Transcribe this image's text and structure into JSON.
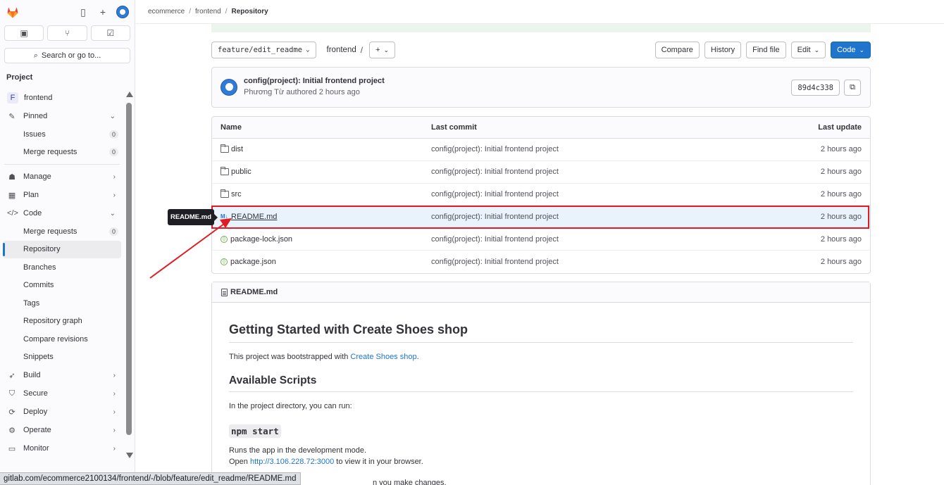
{
  "sidebar": {
    "search_label": "Search or go to...",
    "section_title": "Project",
    "project_initial": "F",
    "project_name": "frontend",
    "items": {
      "pinned": "Pinned",
      "issues": "Issues",
      "issues_count": "0",
      "merge_requests": "Merge requests",
      "merge_requests_count": "0",
      "manage": "Manage",
      "plan": "Plan",
      "code": "Code",
      "code_merge_requests": "Merge requests",
      "code_merge_requests_count": "0",
      "repository": "Repository",
      "branches": "Branches",
      "commits": "Commits",
      "tags": "Tags",
      "repository_graph": "Repository graph",
      "compare_revisions": "Compare revisions",
      "snippets": "Snippets",
      "build": "Build",
      "secure": "Secure",
      "deploy": "Deploy",
      "operate": "Operate",
      "monitor": "Monitor"
    }
  },
  "breadcrumb": [
    "ecommerce",
    "frontend",
    "Repository"
  ],
  "toolbar": {
    "branch": "feature/edit_readme",
    "path_root": "frontend",
    "path_sep": "/",
    "add_label": "+",
    "compare": "Compare",
    "history": "History",
    "find_file": "Find file",
    "edit": "Edit",
    "code": "Code"
  },
  "commit": {
    "title": "config(project): Initial frontend project",
    "author": "Phương Từ",
    "authored_text": "authored 2 hours ago",
    "sha": "89d4c338"
  },
  "table": {
    "headers": {
      "name": "Name",
      "last_commit": "Last commit",
      "last_update": "Last update"
    },
    "rows": [
      {
        "name": "dist",
        "commit": "config(project): Initial frontend project",
        "updated": "2 hours ago",
        "type": "folder"
      },
      {
        "name": "public",
        "commit": "config(project): Initial frontend project",
        "updated": "2 hours ago",
        "type": "folder"
      },
      {
        "name": "src",
        "commit": "config(project): Initial frontend project",
        "updated": "2 hours ago",
        "type": "folder"
      },
      {
        "name": "README.md",
        "commit": "config(project): Initial frontend project",
        "updated": "2 hours ago",
        "type": "markdown"
      },
      {
        "name": "package-lock.json",
        "commit": "config(project): Initial frontend project",
        "updated": "2 hours ago",
        "type": "json"
      },
      {
        "name": "package.json",
        "commit": "config(project): Initial frontend project",
        "updated": "2 hours ago",
        "type": "json"
      }
    ]
  },
  "tooltip": "README.md",
  "readme": {
    "file_name": "README.md",
    "h1": "Getting Started with Create Shoes shop",
    "p1_prefix": "This project was bootstrapped with ",
    "p1_link": "Create Shoes shop",
    "p1_suffix": ".",
    "h2": "Available Scripts",
    "p2": "In the project directory, you can run:",
    "code_heading": "npm start",
    "p3": "Runs the app in the development mode.",
    "p4_prefix": "Open ",
    "p4_link": "http://3.106.228.72:3000",
    "p4_suffix": " to view it in your browser.",
    "p5_partial": "n you make changes."
  },
  "status_url": "gitlab.com/ecommerce2100134/frontend/-/blob/feature/edit_readme/README.md",
  "colors": {
    "accent": "#1f75cb",
    "highlight_box": "#e01b24",
    "annotation_arrow": "#e01b24"
  }
}
